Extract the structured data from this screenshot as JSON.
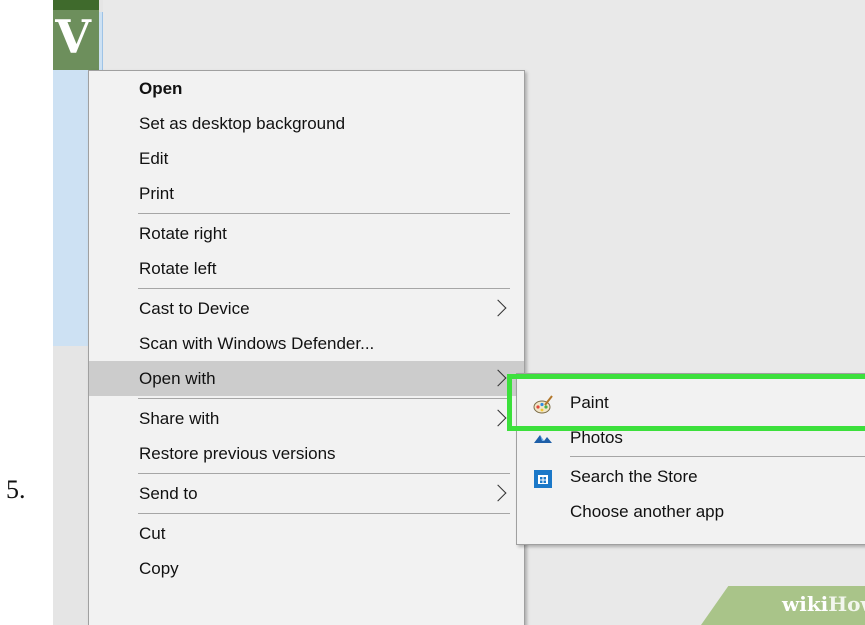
{
  "step_number": "5.",
  "file_thumbnail": {
    "letter": "V"
  },
  "context_menu": {
    "groups": [
      [
        {
          "label": "Open",
          "bold": true
        },
        {
          "label": "Set as desktop background"
        },
        {
          "label": "Edit"
        },
        {
          "label": "Print"
        }
      ],
      [
        {
          "label": "Rotate right"
        },
        {
          "label": "Rotate left"
        }
      ],
      [
        {
          "label": "Cast to Device",
          "submenu": true
        },
        {
          "label": "Scan with Windows Defender..."
        },
        {
          "label": "Open with",
          "submenu": true,
          "active": true
        }
      ],
      [
        {
          "label": "Share with",
          "submenu": true
        },
        {
          "label": "Restore previous versions"
        }
      ],
      [
        {
          "label": "Send to",
          "submenu": true
        }
      ],
      [
        {
          "label": "Cut"
        },
        {
          "label": "Copy"
        }
      ]
    ]
  },
  "open_with_submenu": {
    "items": [
      {
        "label": "Paint",
        "icon": "paint-icon",
        "highlighted": true
      },
      {
        "label": "Photos",
        "icon": "photos-icon"
      },
      {
        "label": "Search the Store",
        "icon": "store-icon",
        "separator_before": true
      },
      {
        "label": "Choose another app",
        "icon": ""
      }
    ]
  },
  "watermark": {
    "part1": "wiki",
    "part2": "How"
  },
  "colors": {
    "highlight_border": "#3ce03c",
    "menu_background": "#f2f2f2",
    "active_item": "#cccccc",
    "watermark_green": "#a9c489"
  }
}
